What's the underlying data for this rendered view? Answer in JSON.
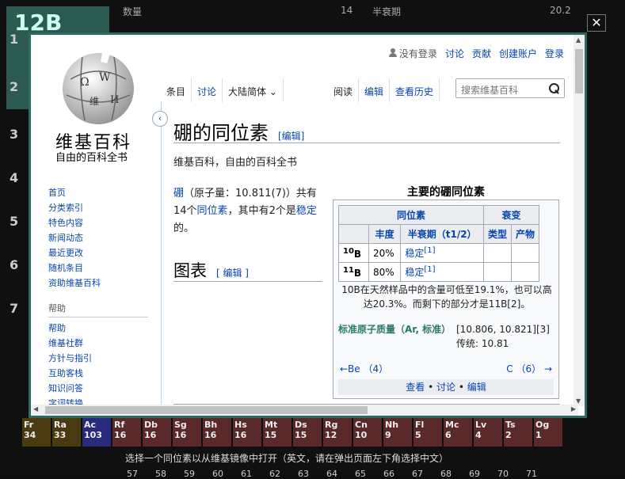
{
  "background": {
    "element_symbol": "12B",
    "info_left_label": "数量",
    "info_left_value": "14",
    "info_right_label": "半衰期",
    "info_right_value": "20.2",
    "row_numbers": [
      "1",
      "2",
      "3",
      "4",
      "5",
      "6",
      "7"
    ],
    "bottom_hint": "选择一个同位素以从维基镜像中打开（英文，请在弹出页面左下角选择中文）",
    "bottom_numbers": [
      "57",
      "58",
      "59",
      "60",
      "61",
      "62",
      "63",
      "64",
      "65",
      "66",
      "67",
      "68",
      "69",
      "70",
      "71"
    ],
    "period7_cells": [
      {
        "sym": "Fr",
        "num": "34"
      },
      {
        "sym": "Ra",
        "num": "33"
      },
      {
        "sym": "Ac",
        "num": "103"
      },
      {
        "sym": "Rf",
        "num": "16"
      },
      {
        "sym": "Db",
        "num": "16"
      },
      {
        "sym": "Sg",
        "num": "16"
      },
      {
        "sym": "Bh",
        "num": "16"
      },
      {
        "sym": "Hs",
        "num": "16"
      },
      {
        "sym": "Mt",
        "num": "15"
      },
      {
        "sym": "Ds",
        "num": "15"
      },
      {
        "sym": "Rg",
        "num": "12"
      },
      {
        "sym": "Cn",
        "num": "10"
      },
      {
        "sym": "Nh",
        "num": "9"
      },
      {
        "sym": "Fl",
        "num": "5"
      },
      {
        "sym": "Mc",
        "num": "6"
      },
      {
        "sym": "Lv",
        "num": "4"
      },
      {
        "sym": "Ts",
        "num": "2"
      },
      {
        "sym": "Og",
        "num": "1"
      }
    ]
  },
  "close_label": "✕",
  "wiki": {
    "site_name": "维基百科",
    "site_tagline": "自由的百科全书",
    "personal": {
      "not_logged_in": "没有登录",
      "talk": "讨论",
      "contributions": "贡献",
      "create_account": "创建账户",
      "login": "登录"
    },
    "tabs_left": {
      "article": "条目",
      "talk": "讨论",
      "variant": "大陆简体"
    },
    "tabs_right": {
      "read": "阅读",
      "edit": "编辑",
      "history": "查看历史"
    },
    "search_placeholder": "搜索维基百科",
    "sidebar": {
      "main": [
        "首页",
        "分类索引",
        "特色内容",
        "新闻动态",
        "最近更改",
        "随机条目",
        "资助维基百科"
      ],
      "help_heading": "帮助",
      "help": [
        "帮助",
        "维基社群",
        "方针与指引",
        "互助客栈",
        "知识问答",
        "字词转换"
      ]
    },
    "title": "硼的同位素",
    "title_edit": "[编辑]",
    "from_line": "维基百科，自由的百科全书",
    "intro": {
      "link1": "硼",
      "text1": "（原子量：10.811(7)）共有14个",
      "link2": "同位素",
      "text2": "，其中有2个是",
      "link3": "稳定",
      "text3": "的。"
    },
    "h2": "图表",
    "h2_edit": "[ 编辑 ]",
    "infobox": {
      "title": "主要的硼同位素",
      "headers": {
        "isotope": "同位素",
        "decay": "衰变",
        "abundance": "丰度",
        "halflife": "半衰期（t1/2）",
        "mode": "类型",
        "product": "产物"
      },
      "rows": [
        {
          "mass": "10",
          "sym": "B",
          "abundance": "20%",
          "halflife": "稳定",
          "ref": "[1]"
        },
        {
          "mass": "11",
          "sym": "B",
          "abundance": "80%",
          "halflife": "稳定",
          "ref": "[1]"
        }
      ],
      "note": "10B在天然样品中的含量可低至19.1%，也可以高达20.3%。而剩下的部分才是11B[2]。",
      "std_label": "标准原子质量（Ar, 标准）",
      "std_value": "[10.806, 10.821][3]",
      "std_conventional": "传统: 10.81",
      "prev": "←Be （4）",
      "next": "C （6） →",
      "footer": {
        "view": "查看",
        "talk": "讨论",
        "edit": "编辑",
        "sep": " • "
      }
    }
  }
}
